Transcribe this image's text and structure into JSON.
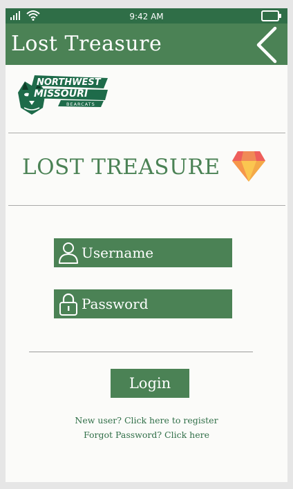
{
  "status_bar": {
    "time": "9:42 AM"
  },
  "app_bar": {
    "title": "Lost Treasure"
  },
  "logo": {
    "line1": "NORTHWEST",
    "line2": "MISSOURI",
    "line3": "BEARCATS",
    "color": "#1e6b4a"
  },
  "heading": "LOST TREASURE",
  "form": {
    "username_placeholder": "Username",
    "username_value": "",
    "password_placeholder": "Password",
    "password_value": "",
    "login_label": "Login"
  },
  "links": {
    "register": "New user? Click here to register",
    "forgot": "Forgot Password? Click here"
  },
  "icons": {
    "back": "chevron-left-icon",
    "user": "user-icon",
    "lock": "lock-icon",
    "gem": "gem-icon"
  },
  "colors": {
    "primary": "#4b8255",
    "status_bar": "#2f6e47",
    "background": "#fbfbf9"
  }
}
